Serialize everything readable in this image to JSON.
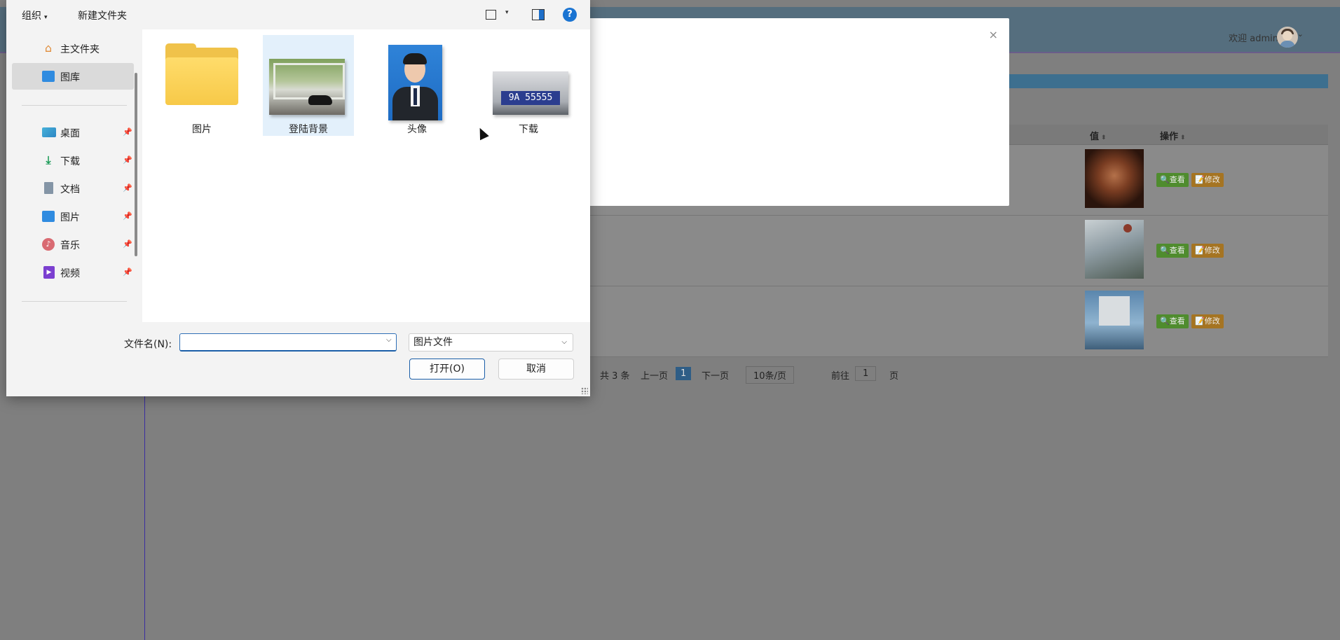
{
  "background": {
    "header": {
      "welcome": "欢迎 admin",
      "caret": "⌄"
    },
    "modal": {
      "close_glyph": "×"
    },
    "table": {
      "columns": [
        {
          "label": "值",
          "sort": "⬍"
        },
        {
          "label": "操作",
          "sort": "⬍"
        }
      ],
      "rows": [
        {
          "view_label": "🔍查看",
          "edit_label": "📝修改"
        },
        {
          "view_label": "🔍查看",
          "edit_label": "📝修改"
        },
        {
          "view_label": "🔍查看",
          "edit_label": "📝修改"
        }
      ]
    },
    "pager": {
      "total": "共 3 条",
      "prev": "上一页",
      "current_page": "1",
      "next": "下一页",
      "page_size": "10条/页",
      "goto_label": "前往",
      "goto_value": "1",
      "page_suffix": "页"
    }
  },
  "dialog": {
    "toolbar": {
      "organize": "组织",
      "organize_caret": "▾",
      "new_folder": "新建文件夹",
      "view_caret": "▾",
      "help": "?"
    },
    "nav": {
      "top": [
        {
          "label": "主文件夹",
          "icon": "home-icon",
          "glyph": "⌂"
        },
        {
          "label": "图库",
          "icon": "gallery-icon",
          "glyph": ""
        }
      ],
      "pinned": [
        {
          "label": "桌面",
          "icon": "desktop-icon",
          "glyph": ""
        },
        {
          "label": "下载",
          "icon": "download-icon",
          "glyph": "⤓"
        },
        {
          "label": "文档",
          "icon": "document-icon",
          "glyph": ""
        },
        {
          "label": "图片",
          "icon": "pictures-icon",
          "glyph": ""
        },
        {
          "label": "音乐",
          "icon": "music-icon",
          "glyph": "♪"
        },
        {
          "label": "视频",
          "icon": "video-icon",
          "glyph": "▶"
        }
      ],
      "pin_glyph": "📌"
    },
    "files": [
      {
        "label": "图片",
        "kind": "folder"
      },
      {
        "label": "登陆背景",
        "kind": "image"
      },
      {
        "label": "头像",
        "kind": "image"
      },
      {
        "label": "下载",
        "kind": "image",
        "plate_text": "9A 55555"
      }
    ],
    "footer": {
      "filename_label": "文件名(N):",
      "filename_value": "",
      "filename_caret": "⌵",
      "file_type": "图片文件",
      "file_type_caret": "⌵",
      "open_button": "打开(O)",
      "cancel_button": "取消"
    }
  },
  "colors": {
    "accent": "#1a74d2",
    "folder": "#f0c24a",
    "selection": "#e3f0fb"
  }
}
